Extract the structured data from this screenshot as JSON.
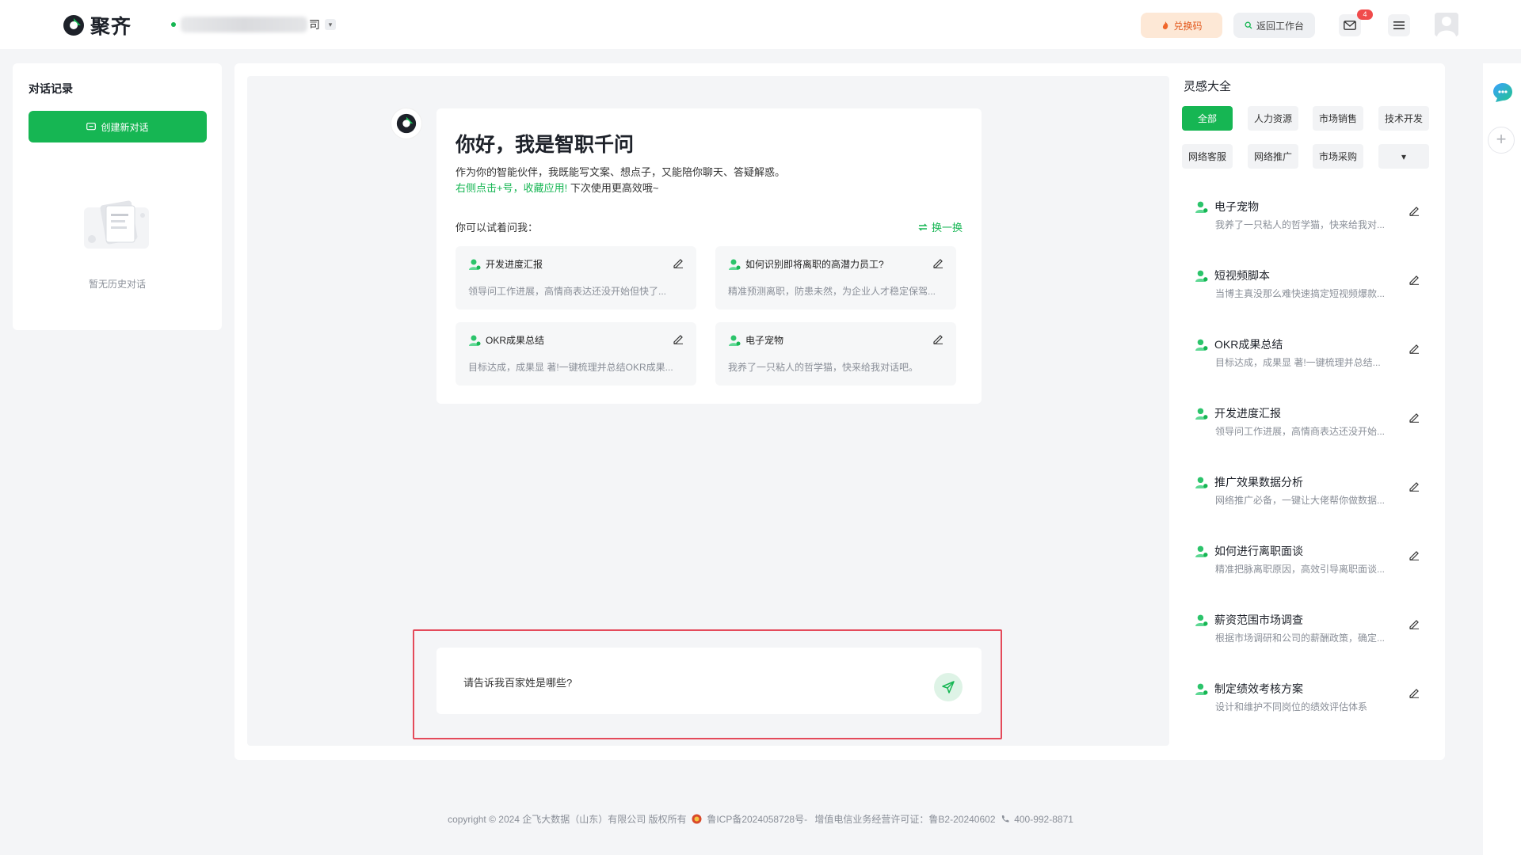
{
  "header": {
    "logo_text": "聚齐",
    "org_suffix": "司",
    "redeem_label": "兑换码",
    "back_label": "返回工作台",
    "mail_badge": "4"
  },
  "left_panel": {
    "title": "对话记录",
    "new_chat_label": "创建新对话",
    "empty_text": "暂无历史对话"
  },
  "welcome": {
    "title": "你好，我是智职千问",
    "desc": "作为你的智能伙伴，我既能写文案、想点子，又能陪你聊天、答疑解惑。",
    "hint_green": "右侧点击+号，收藏应用!",
    "hint_rest": " 下次使用更高效哦~",
    "ask_label": "你可以试着问我：",
    "refresh_label": "换一换",
    "questions": [
      {
        "title": "开发进度汇报",
        "desc": "领导问工作进展，高情商表达还没开始但快了..."
      },
      {
        "title": "如何识别即将离职的高潜力员工?",
        "desc": "精准预测离职，防患未然，为企业人才稳定保驾..."
      },
      {
        "title": "OKR成果总结",
        "desc": "目标达成，成果显 著!一键梳理并总结OKR成果..."
      },
      {
        "title": "电子宠物",
        "desc": "我养了一只粘人的哲学猫，快来给我对话吧。"
      }
    ]
  },
  "chat_input": {
    "value": "请告诉我百家姓是哪些?"
  },
  "inspiration": {
    "title": "灵感大全",
    "categories": [
      "全部",
      "人力资源",
      "市场销售",
      "技术开发",
      "网络客服",
      "网络推广",
      "市场采购"
    ],
    "more_label": "▾",
    "items": [
      {
        "title": "电子宠物",
        "desc": "我养了一只粘人的哲学猫，快来给我对..."
      },
      {
        "title": "短视频脚本",
        "desc": "当博主真没那么难快速搞定短视频爆款..."
      },
      {
        "title": "OKR成果总结",
        "desc": "目标达成，成果显 著!一键梳理并总结..."
      },
      {
        "title": "开发进度汇报",
        "desc": "领导问工作进展，高情商表达还没开始..."
      },
      {
        "title": "推广效果数据分析",
        "desc": "网络推广必备，一键让大佬帮你做数据..."
      },
      {
        "title": "如何进行离职面谈",
        "desc": "精准把脉离职原因，高效引导离职面谈..."
      },
      {
        "title": "薪资范围市场调查",
        "desc": "根据市场调研和公司的薪酬政策，确定..."
      },
      {
        "title": "制定绩效考核方案",
        "desc": "设计和维护不同岗位的绩效评估体系"
      }
    ]
  },
  "footer": {
    "copyright": "copyright © 2024 企飞大数据（山东）有限公司 版权所有",
    "icp": "鲁ICP备2024058728号-",
    "license": "增值电信业务经营许可证：鲁B2-20240602",
    "phone": "400-992-8871"
  },
  "colors": {
    "brand_green": "#16b653",
    "highlight_red": "#e44a5a"
  }
}
